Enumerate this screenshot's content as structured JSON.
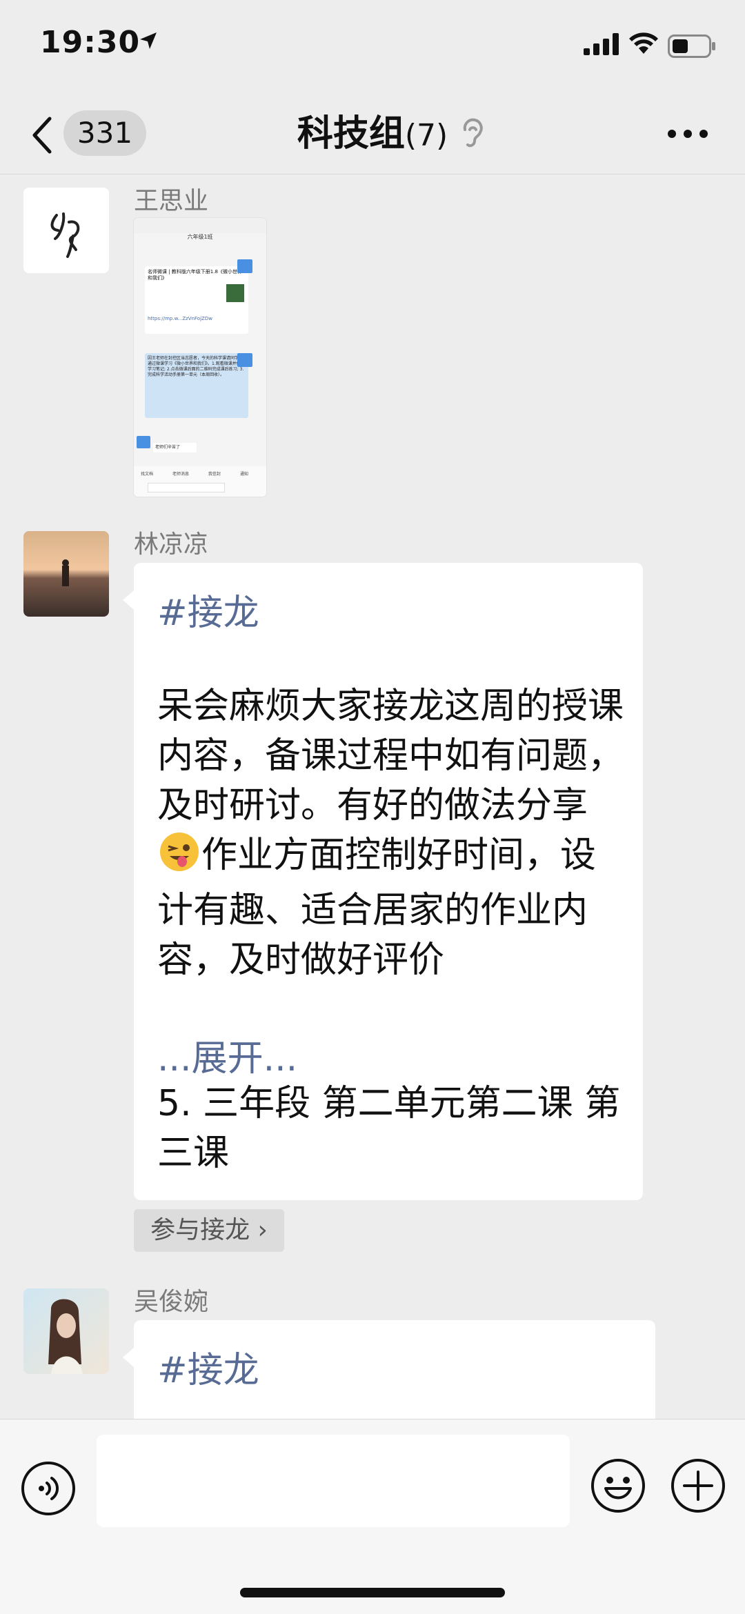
{
  "status_bar": {
    "time": "19:30"
  },
  "nav": {
    "badge_count": "331",
    "title": "科技组",
    "member_count": "(7)"
  },
  "messages": [
    {
      "sender": "王思业",
      "type": "image",
      "image_lines": {
        "title": "六年级1班",
        "card_title": "名师微课 | 教科版六年级下册1.8《微小世界和我们》",
        "link": "https://mp.w...ZzVnFojZDw",
        "notice": "因王老师在封控区当志愿者，今天的科学课请同学们通过微课学习《微小世界和我们》。1.观看微课并做好学习笔记; 2.点击微课后面的二维码完成课后练习; 3.完成科学活动手册第一单元（本周回收）。",
        "reply": "老师们辛苦了",
        "toolbar": [
          "找文档",
          "老师消息",
          "我信封",
          "通知"
        ]
      }
    },
    {
      "sender": "林凉凉",
      "type": "jielong",
      "tag": "#接龙",
      "body_a": "呆会麻烦大家接龙这周的授课内容，备课过程中如有问题，及时研讨。有好的做法分享",
      "body_b": "作业方面控制好时间，设计有趣、适合居家的作业内容，及时做好评价",
      "expand": "...展开...",
      "item": "5. 三年段  第二单元第二课 第三课",
      "join_label": "参与接龙 ›"
    },
    {
      "sender": "吴俊婉",
      "type": "jielong",
      "tag": "#接龙"
    }
  ],
  "colors": {
    "link_blue": "#576b95",
    "background": "#ededed",
    "bubble": "#ffffff"
  }
}
